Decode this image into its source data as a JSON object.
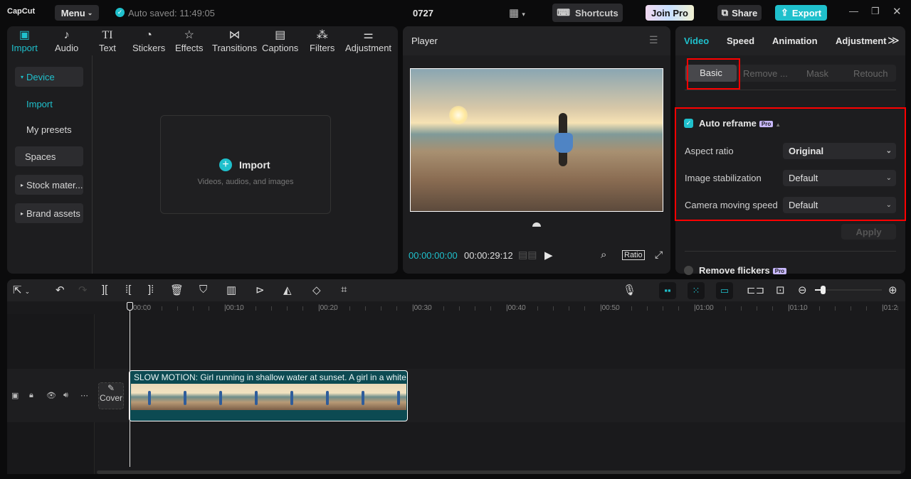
{
  "app": {
    "logo": "CapCut",
    "menu": "Menu",
    "autosave": "Auto saved: 11:49:05",
    "project": "0727",
    "shortcuts": "Shortcuts",
    "join_pro": "Join Pro",
    "share": "Share",
    "export": "Export",
    "accent": "#1fc0cc"
  },
  "media_tabs": [
    {
      "label": "Import",
      "icon": "import-icon"
    },
    {
      "label": "Audio",
      "icon": "audio-icon"
    },
    {
      "label": "Text",
      "icon": "text-icon"
    },
    {
      "label": "Stickers",
      "icon": "sticker-icon"
    },
    {
      "label": "Effects",
      "icon": "effects-icon"
    },
    {
      "label": "Transitions",
      "icon": "transitions-icon"
    },
    {
      "label": "Captions",
      "icon": "captions-icon"
    },
    {
      "label": "Filters",
      "icon": "filters-icon"
    },
    {
      "label": "Adjustment",
      "icon": "adjustment-icon"
    }
  ],
  "sidebar": {
    "device": "Device",
    "import": "Import",
    "presets": "My presets",
    "spaces": "Spaces",
    "stock": "Stock mater...",
    "brand": "Brand assets"
  },
  "import_box": {
    "label": "Import",
    "hint": "Videos, audios, and images"
  },
  "player": {
    "title": "Player",
    "current": "00:00:00:00",
    "total": "00:00:29:12",
    "ratio": "Ratio"
  },
  "right": {
    "tabs": [
      "Video",
      "Speed",
      "Animation",
      "Adjustment"
    ],
    "subtabs": [
      "Basic",
      "Remove ...",
      "Mask",
      "Retouch"
    ],
    "auto_reframe": {
      "label": "Auto reframe",
      "checked": true,
      "pro": "Pro"
    },
    "aspect_label": "Aspect ratio",
    "aspect_value": "Original",
    "stab_label": "Image stabilization",
    "stab_value": "Default",
    "speed_label": "Camera moving speed",
    "speed_value": "Default",
    "apply": "Apply",
    "remove_flickers": "Remove flickers",
    "remove_flickers_checked": false
  },
  "timeline": {
    "ticks": [
      "00:00",
      "00:10",
      "00:20",
      "00:30",
      "00:40",
      "00:50",
      "01:00",
      "01:10",
      "01:2"
    ],
    "cover": "Cover",
    "clip_title": "SLOW MOTION: Girl running in shallow water at sunset. A girl in a white d"
  }
}
